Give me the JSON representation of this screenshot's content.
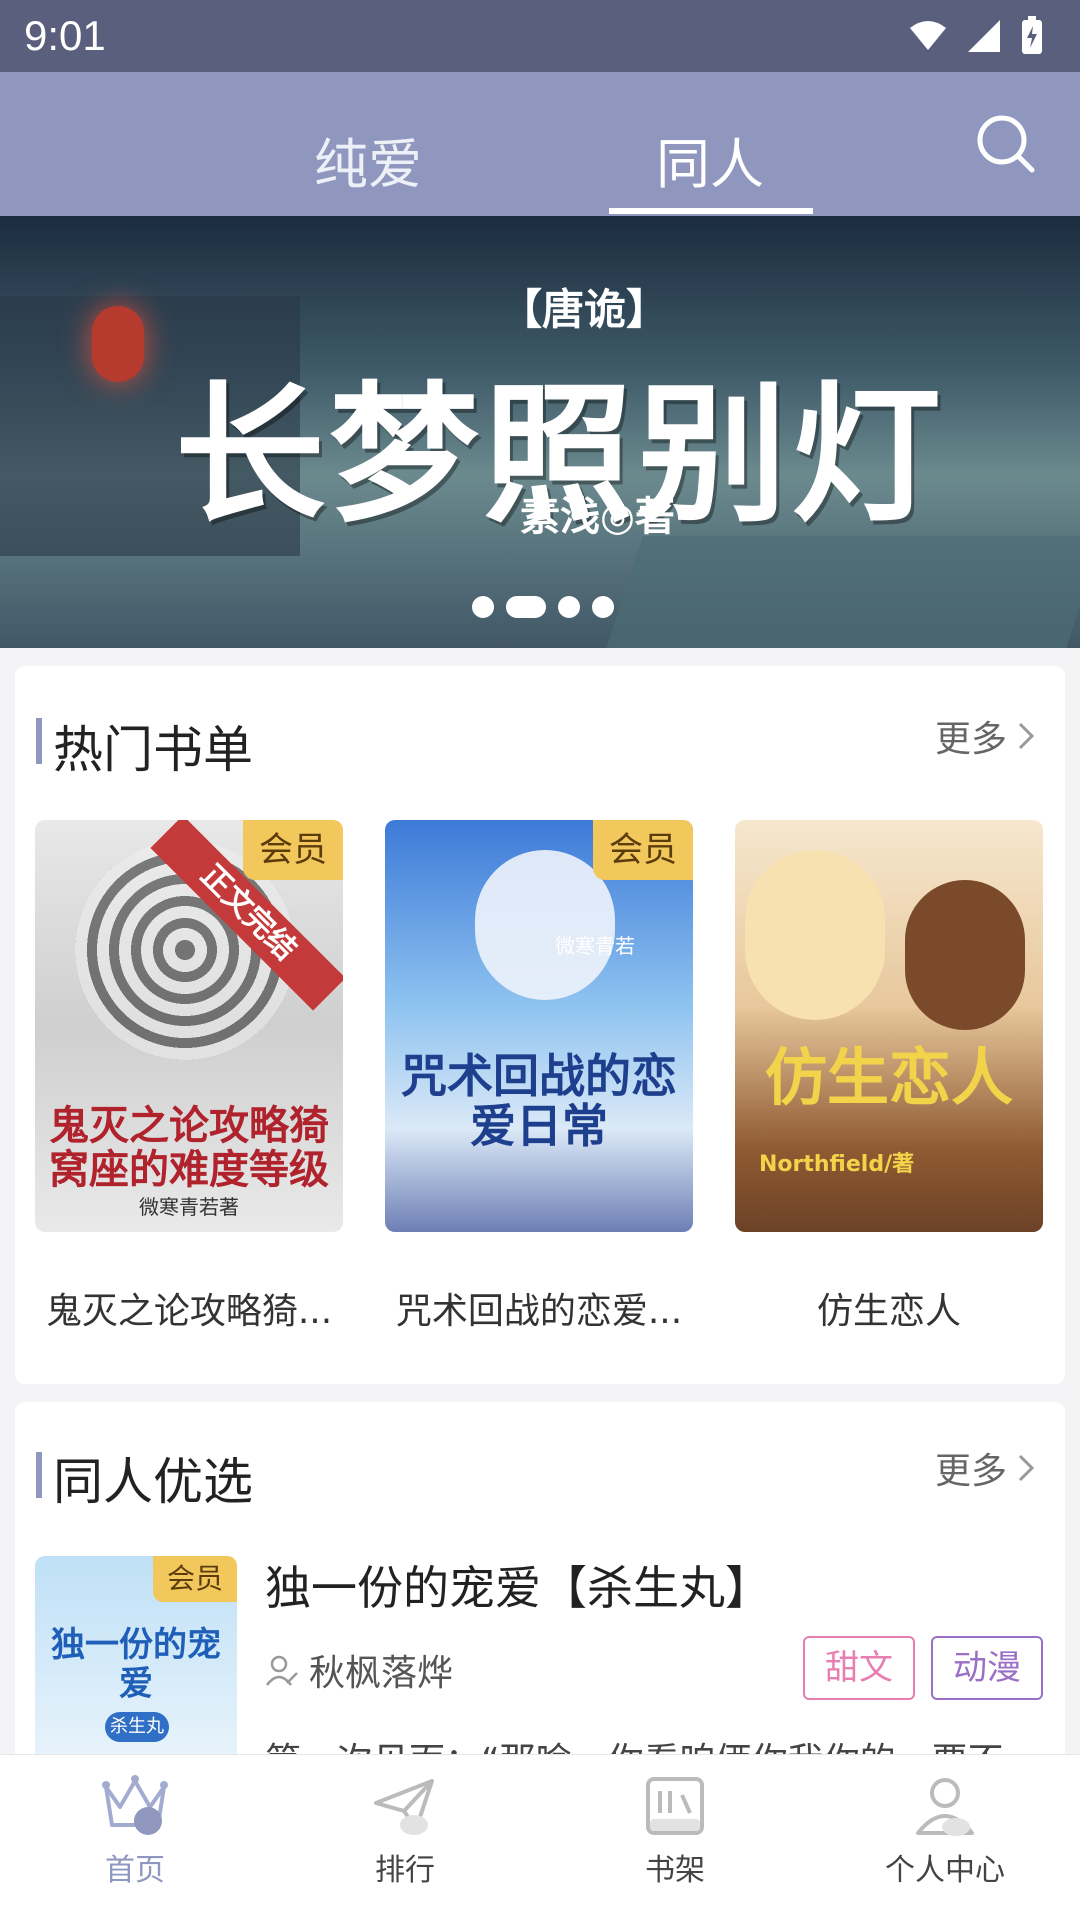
{
  "status_bar": {
    "time": "9:01"
  },
  "header": {
    "tabs": [
      {
        "label": "纯爱",
        "active": false
      },
      {
        "label": "同人",
        "active": true
      }
    ],
    "search_icon": "search-icon"
  },
  "banner": {
    "subtitle": "【唐诡】",
    "title": "长梦照别灯",
    "author": "素浅◎著",
    "dots": 4,
    "active_dot": 2
  },
  "hot_lists": {
    "title": "热门书单",
    "more": "更多",
    "books": [
      {
        "name": "鬼灭之论攻略猗...",
        "badge": "会员",
        "cover_text": "鬼灭之论攻略猗窝座的难度等级",
        "cover_author": "微寒青若著",
        "ribbon": "正文完结"
      },
      {
        "name": "咒术回战的恋爱...",
        "badge": "会员",
        "cover_text": "咒术回战的恋爱日常",
        "cover_author": "微寒青若"
      },
      {
        "name": "仿生恋人",
        "badge": "",
        "cover_text": "仿生恋人",
        "cover_author": "Northfield/著"
      }
    ]
  },
  "featured": {
    "title": "同人优选",
    "more": "更多",
    "item": {
      "badge": "会员",
      "cover_text": "独一份的宠爱",
      "cover_sub": "杀生丸",
      "title": "独一份的宠爱【杀生丸】",
      "author": "秋枫落烨",
      "tags": [
        "甜文",
        "动漫"
      ],
      "desc": "第一次见面：“那啥，你看咱俩你我你的，要不"
    }
  },
  "bottom_nav": [
    {
      "label": "首页",
      "icon": "crown-icon",
      "active": true
    },
    {
      "label": "排行",
      "icon": "paper-plane-icon",
      "active": false
    },
    {
      "label": "书架",
      "icon": "bookshelf-icon",
      "active": false
    },
    {
      "label": "个人中心",
      "icon": "user-icon",
      "active": false
    }
  ],
  "colors": {
    "accent": "#8f97bf",
    "status_bar": "#5b5f7e",
    "badge": "#f2c75c",
    "tag_sweet": "#e77fb2",
    "tag_anime": "#9a6fc6"
  }
}
